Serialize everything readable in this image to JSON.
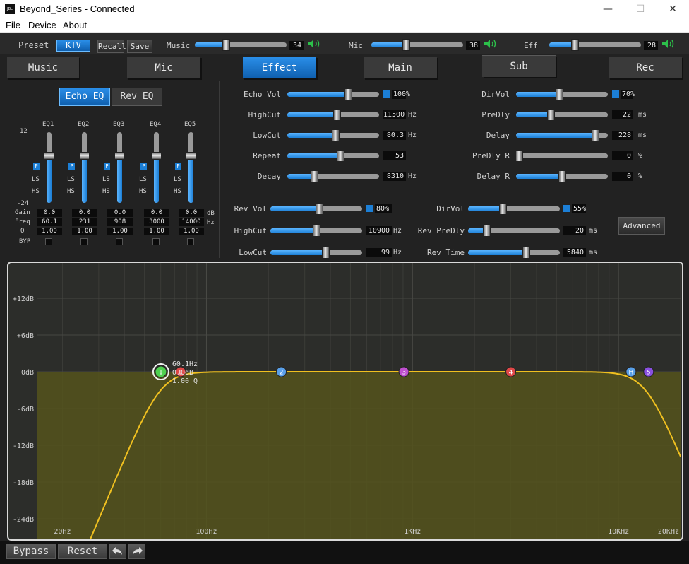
{
  "window": {
    "title": "Beyond_Series - Connected",
    "icon_text": "JBL",
    "minimize": "—",
    "maximize": "☐",
    "close": "✕"
  },
  "menu": [
    "File",
    "Device",
    "About"
  ],
  "topbar": {
    "preset_label": "Preset",
    "preset_value": "KTV",
    "recall": "Recall",
    "save": "Save",
    "music_label": "Music",
    "music_value": "34",
    "music_level": 0.34,
    "mic_label": "Mic",
    "mic_value": "38",
    "mic_level": 0.38,
    "eff_label": "Eff",
    "eff_value": "28",
    "eff_level": 0.28
  },
  "tabs": [
    {
      "label": "Music"
    },
    {
      "label": "Mic"
    },
    {
      "label": "Effect",
      "active": true
    },
    {
      "label": "Main"
    },
    {
      "label": "Sub"
    },
    {
      "label": "Rec"
    }
  ],
  "eq": {
    "echo_tab": "Echo EQ",
    "rev_tab": "Rev EQ",
    "top_db": "12",
    "bottom_db": "-24",
    "row_labels": {
      "gain": "Gain",
      "freq": "Freq",
      "q": "Q",
      "byp": "BYP"
    },
    "units": {
      "gain": "dB",
      "freq": "Hz"
    },
    "bands": [
      {
        "name": "EQ1",
        "gain": "0.0",
        "freq": "60.1",
        "q": "1.00"
      },
      {
        "name": "EQ2",
        "gain": "0.0",
        "freq": "231",
        "q": "1.00"
      },
      {
        "name": "EQ3",
        "gain": "0.0",
        "freq": "908",
        "q": "1.00"
      },
      {
        "name": "EQ4",
        "gain": "0.0",
        "freq": "3000",
        "q": "1.00"
      },
      {
        "name": "EQ5",
        "gain": "0.0",
        "freq": "14000",
        "q": "1.00"
      }
    ],
    "p": "P",
    "ls": "LS",
    "hs": "HS"
  },
  "echo": {
    "left": [
      {
        "label": "Echo Vol",
        "value": "100%",
        "plus": true,
        "level": 0.66
      },
      {
        "label": "HighCut",
        "value": "11500",
        "unit": "Hz",
        "level": 0.54
      },
      {
        "label": "LowCut",
        "value": "80.3",
        "unit": "Hz",
        "level": 0.52
      },
      {
        "label": "Repeat",
        "value": "53",
        "level": 0.58
      },
      {
        "label": "Decay",
        "value": "8310",
        "unit": "Hz",
        "level": 0.29
      }
    ],
    "right": [
      {
        "label": "DirVol",
        "value": "70%",
        "plus": true,
        "level": 0.47
      },
      {
        "label": "PreDly",
        "value": "22",
        "unit": "ms",
        "level": 0.38
      },
      {
        "label": "Delay",
        "value": "228",
        "unit": "ms",
        "level": 0.86
      },
      {
        "label": "PreDly R",
        "value": "0",
        "unit": "%",
        "level": 0.03
      },
      {
        "label": "Delay R",
        "value": "0",
        "unit": "%",
        "level": 0.5
      }
    ]
  },
  "reverb": {
    "left": [
      {
        "label": "Rev Vol",
        "value": "80%",
        "plus": true,
        "level": 0.53
      },
      {
        "label": "HighCut",
        "value": "10900",
        "unit": "Hz",
        "level": 0.5
      },
      {
        "label": "LowCut",
        "value": "99",
        "unit": "Hz",
        "level": 0.6
      }
    ],
    "right": [
      {
        "label": "DirVol",
        "value": "55%",
        "plus": true,
        "level": 0.38
      },
      {
        "label": "Rev PreDly",
        "value": "20",
        "unit": "ms",
        "level": 0.2
      },
      {
        "label": "Rev Time",
        "value": "5840",
        "unit": "ms",
        "level": 0.63
      }
    ],
    "advanced": "Advanced"
  },
  "graph": {
    "db_labels": [
      "+12dB",
      "+6dB",
      "0dB",
      "-6dB",
      "-12dB",
      "-18dB",
      "-24dB"
    ],
    "freq_labels": [
      "20Hz",
      "100Hz",
      "1KHz",
      "10KHz",
      "20KHz"
    ],
    "marker_info": [
      "60.1Hz",
      "0.0dB",
      "1.00 Q"
    ],
    "markers": [
      {
        "label": "1",
        "color": "#4fd04f"
      },
      {
        "label": "L",
        "color": "#e04848"
      },
      {
        "label": "2",
        "color": "#5aa0e8"
      },
      {
        "label": "3",
        "color": "#c050d0"
      },
      {
        "label": "4",
        "color": "#e04848"
      },
      {
        "label": "H",
        "color": "#5aa0e8"
      },
      {
        "label": "5",
        "color": "#8a50e0"
      }
    ],
    "curve_color": "#f0c020"
  },
  "bottom": {
    "bypass": "Bypass",
    "reset": "Reset",
    "undo_icon": "undo-icon",
    "redo_icon": "redo-icon"
  }
}
